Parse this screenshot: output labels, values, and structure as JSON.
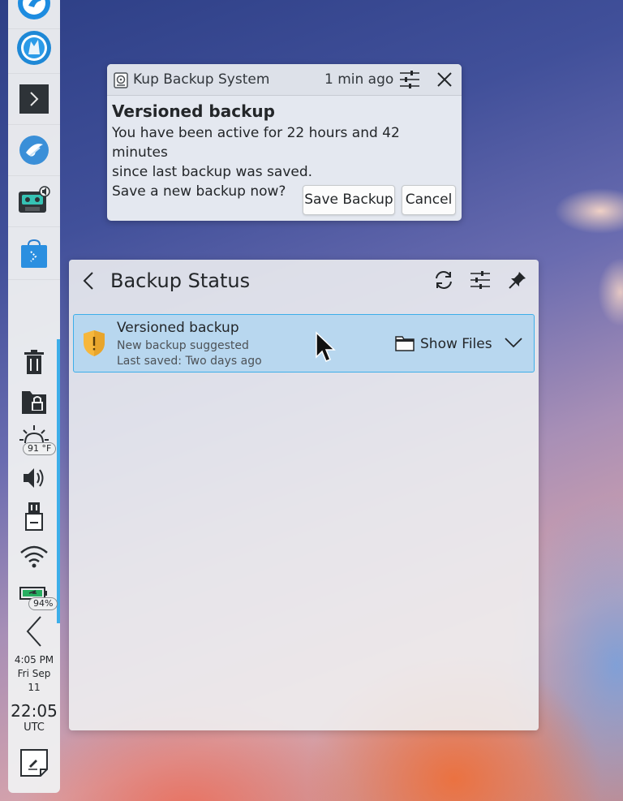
{
  "notification": {
    "app_name": "Kup Backup System",
    "time": "1 min ago",
    "title": "Versioned backup",
    "body_line1": "You have been active for 22 hours and 42 minutes",
    "body_line2": "since last backup was saved.",
    "body_line3": "Save a new backup now?",
    "save_label": "Save Backup",
    "cancel_label": "Cancel"
  },
  "status_panel": {
    "title": "Backup Status",
    "item": {
      "name": "Versioned backup",
      "status": "New backup suggested",
      "last_saved": "Last saved: Two days ago",
      "show_files_label": "Show Files"
    }
  },
  "system_tray": {
    "weather_temp": "91 °F",
    "battery_percent": "94%"
  },
  "clock": {
    "local_time": "4:05 PM",
    "local_day": "Fri Sep",
    "local_date": "11",
    "utc_time": "22:05",
    "utc_label": "UTC"
  },
  "colors": {
    "accent": "#3daee9",
    "selection": "#b8d7ef",
    "warning": "#f6b73c"
  }
}
